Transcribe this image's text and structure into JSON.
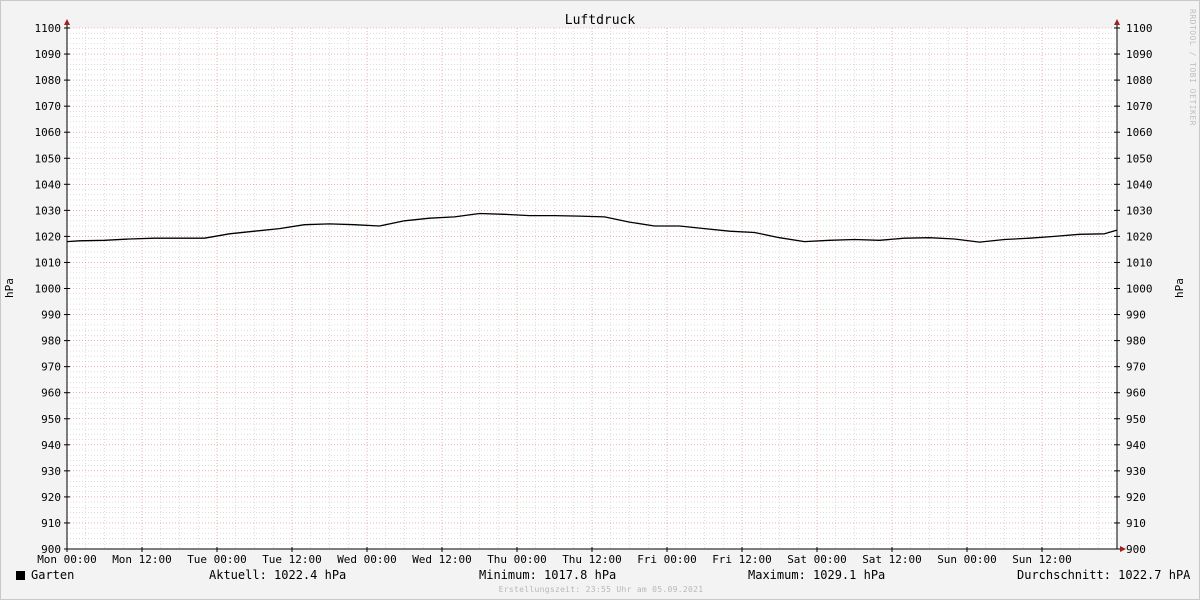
{
  "chart_data": {
    "type": "line",
    "title": "Luftdruck",
    "ylabel_left": "hPa",
    "ylabel_right": "hPa",
    "ylim": [
      900,
      1100
    ],
    "y_ticks": [
      "900",
      "910",
      "920",
      "930",
      "940",
      "950",
      "960",
      "970",
      "980",
      "990",
      "1000",
      "1010",
      "1020",
      "1030",
      "1040",
      "1050",
      "1060",
      "1070",
      "1080",
      "1090",
      "1100"
    ],
    "x_ticks": [
      "Mon 00:00",
      "Mon 12:00",
      "Tue 00:00",
      "Tue 12:00",
      "Wed 00:00",
      "Wed 12:00",
      "Thu 00:00",
      "Thu 12:00",
      "Fri 00:00",
      "Fri 12:00",
      "Sat 00:00",
      "Sat 12:00",
      "Sun 00:00",
      "Sun 12:00"
    ],
    "x_unit": "hours since Mon 00:00",
    "xlim": [
      0,
      168
    ],
    "grid": true,
    "series": [
      {
        "name": "Garten",
        "color": "#000000",
        "x": [
          0,
          2,
          6,
          10,
          14,
          18,
          22,
          26,
          30,
          34,
          38,
          42,
          46,
          50,
          54,
          58,
          62,
          66,
          70,
          74,
          78,
          82,
          86,
          90,
          94,
          98,
          102,
          106,
          110,
          114,
          118,
          122,
          126,
          130,
          134,
          138,
          142,
          146,
          150,
          154,
          158,
          162,
          166,
          168
        ],
        "values": [
          1018.0,
          1018.3,
          1018.5,
          1019.0,
          1019.3,
          1019.3,
          1019.3,
          1021.0,
          1022.0,
          1023.0,
          1024.5,
          1024.8,
          1024.5,
          1024.0,
          1026.0,
          1027.0,
          1027.5,
          1028.8,
          1028.5,
          1028.0,
          1028.0,
          1027.8,
          1027.5,
          1025.5,
          1024.0,
          1024.0,
          1023.0,
          1022.0,
          1021.5,
          1019.5,
          1018.0,
          1018.5,
          1018.8,
          1018.5,
          1019.3,
          1019.5,
          1019.0,
          1017.8,
          1018.8,
          1019.3,
          1020.0,
          1020.8,
          1021.0,
          1022.4
        ]
      }
    ]
  },
  "legend": {
    "name": "Garten",
    "current": "Aktuell: 1022.4 hPa",
    "minimum": "Minimum: 1017.8 hPa",
    "maximum": "Maximum: 1029.1 hPa",
    "average": "Durchschnitt: 1022.7 hPA"
  },
  "footer": "Erstellungszeit: 23:55 Uhr am 05.09.2021",
  "watermark": "RRDTOOL / TOBI OETIKER",
  "colors": {
    "background": "#f3f3f3",
    "plot_background": "#ffffff",
    "major_grid": "#e08080",
    "minor_grid": "#c8c8c8",
    "axis_arrow": "#a02020",
    "series": "#000000"
  }
}
